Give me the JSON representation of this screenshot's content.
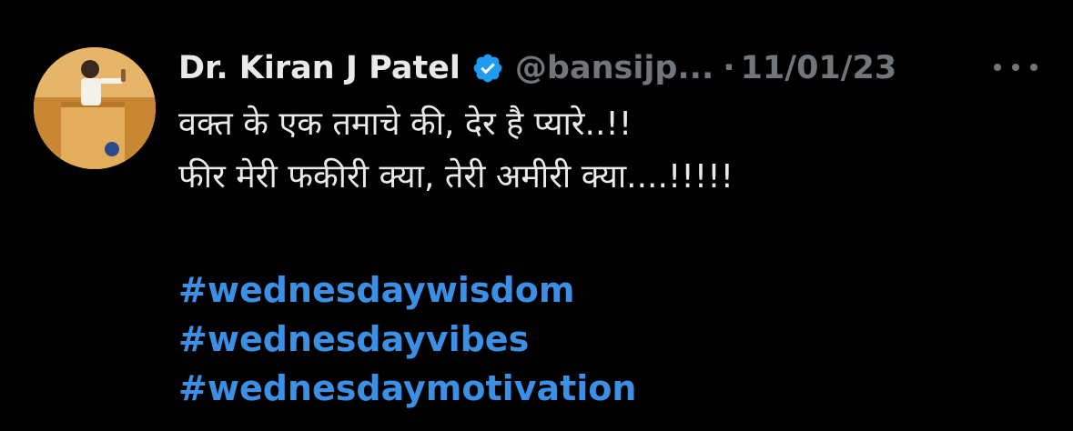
{
  "tweet": {
    "author_name": "Dr. Kiran J Patel",
    "handle": "@bansijp...",
    "separator": "·",
    "date": "11/01/23",
    "verified_icon": "verified-badge-icon",
    "more_icon": "more-options-icon",
    "text_lines": [
      "वक्त के एक तमाचे की, देर है प्यारे..!!",
      "फीर मेरी फकीरी क्या, तेरी अमीरी क्या....!!!!!"
    ],
    "hashtags": [
      "#wednesdaywisdom",
      "#wednesdayvibes",
      "#wednesdaymotivation"
    ]
  },
  "colors": {
    "background": "#000000",
    "primary_text": "#e7e9ea",
    "secondary_text": "#71767b",
    "hashtag": "#3b8fe4",
    "verified": "#1d9bf0"
  }
}
